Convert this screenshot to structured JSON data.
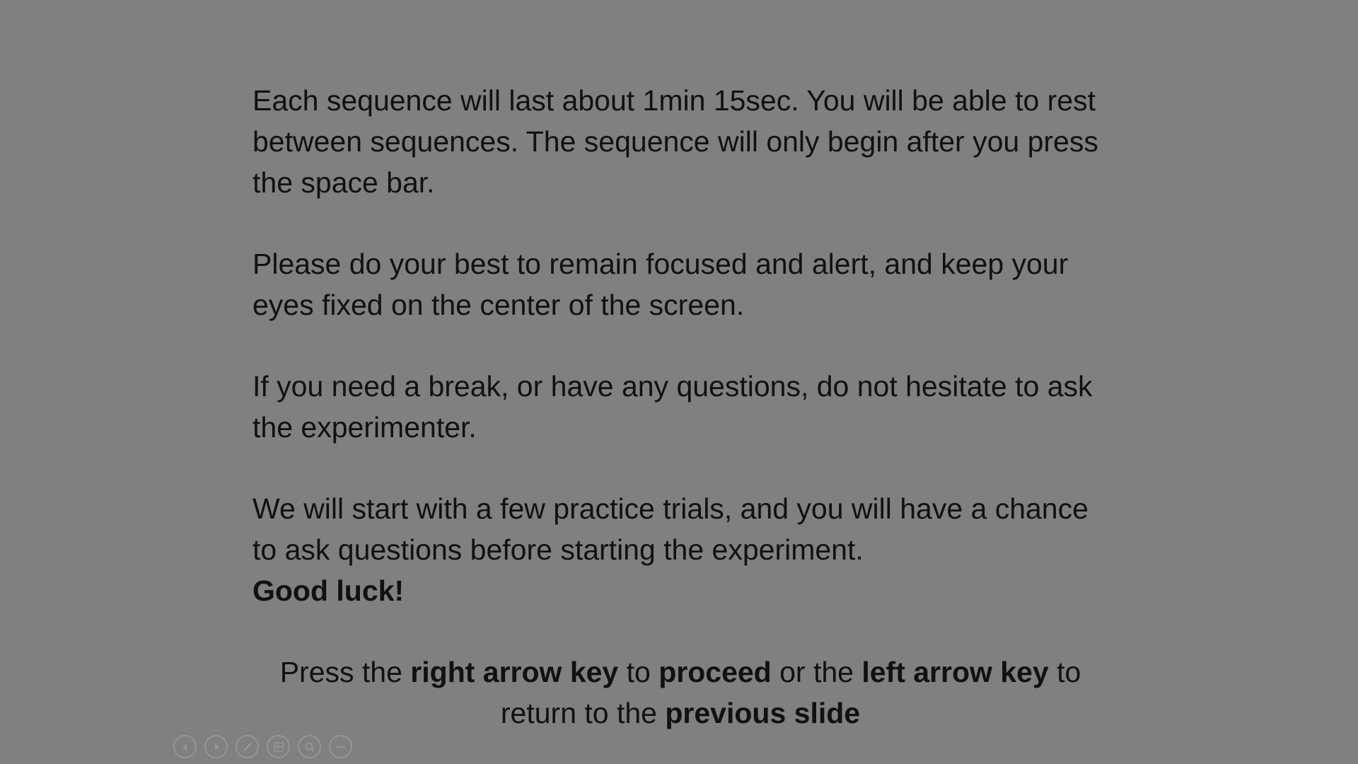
{
  "slide": {
    "paragraphs": [
      "Each sequence will last about 1min 15sec. You will be able to rest between sequences. The sequence will only begin after you press the space bar.",
      "Please do your best to remain focused and alert, and keep your eyes fixed on the center of the screen.",
      "If you need a break, or have any questions, do not hesitate to ask the experimenter.",
      "We will start with a few practice trials, and you will have a chance to ask questions before starting the experiment."
    ],
    "good_luck": "Good luck!",
    "instruction": {
      "part1": "Press the ",
      "bold1": "right arrow key",
      "part2": " to ",
      "bold2": "proceed",
      "part3": " or the ",
      "bold3": "left arrow key",
      "part4": " to return to the ",
      "bold4": "previous slide"
    }
  },
  "toolbar": {
    "icons": [
      "previous-icon",
      "next-icon",
      "pen-icon",
      "slides-grid-icon",
      "zoom-icon",
      "more-icon"
    ]
  }
}
